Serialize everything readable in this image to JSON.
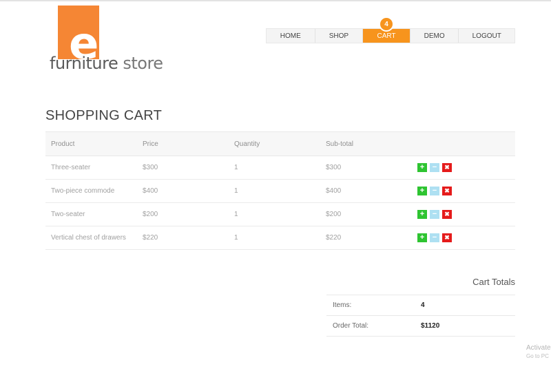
{
  "brand": {
    "logo_letter": "e",
    "logo_word1": "furniture",
    "logo_word2": "store",
    "accent_color": "#f7941d"
  },
  "nav": {
    "items": [
      {
        "label": "HOME"
      },
      {
        "label": "SHOP"
      },
      {
        "label": "CART",
        "active": true
      },
      {
        "label": "DEMO"
      },
      {
        "label": "LOGOUT"
      }
    ],
    "cart_count": "4"
  },
  "page_title": "SHOPPING CART",
  "cart": {
    "headers": [
      "Product",
      "Price",
      "Quantity",
      "Sub-total"
    ],
    "rows": [
      {
        "product": "Three-seater",
        "price": "$300",
        "quantity": "1",
        "subtotal": "$300"
      },
      {
        "product": "Two-piece commode",
        "price": "$400",
        "quantity": "1",
        "subtotal": "$400"
      },
      {
        "product": "Two-seater",
        "price": "$200",
        "quantity": "1",
        "subtotal": "$200"
      },
      {
        "product": "Vertical chest of drawers",
        "price": "$220",
        "quantity": "1",
        "subtotal": "$220"
      }
    ],
    "action_icons": [
      "plus-icon",
      "minus-icon",
      "remove-icon"
    ]
  },
  "totals": {
    "title": "Cart Totals",
    "items_label": "Items:",
    "items_value": "4",
    "order_total_label": "Order Total:",
    "order_total_value": "$1120"
  },
  "watermark": {
    "line1": "Activate",
    "line2": "Go to PC"
  }
}
